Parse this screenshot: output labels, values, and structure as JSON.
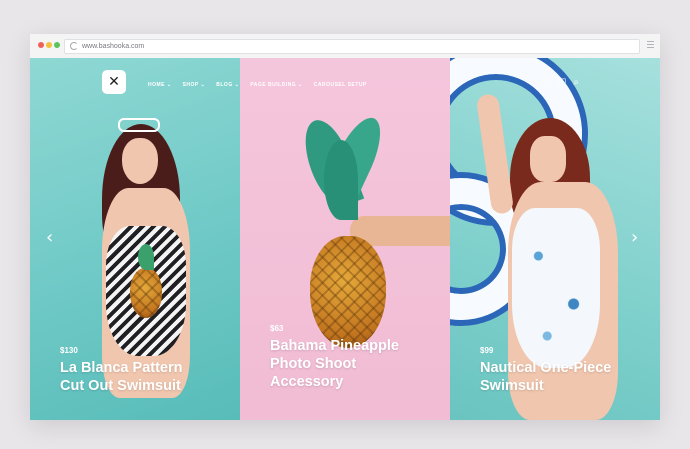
{
  "browser": {
    "url": "www.bashooka.com"
  },
  "header": {
    "logo_glyph": "✕",
    "nav": [
      {
        "label": "HOME ⌄"
      },
      {
        "label": "SHOP ⌄"
      },
      {
        "label": "BLOG ⌄"
      },
      {
        "label": "PAGE BUILDING ⌄"
      },
      {
        "label": "CAROUSEL SETUP"
      }
    ],
    "icons": [
      "heart-icon",
      "bag-icon",
      "search-icon"
    ],
    "icon_glyphs": {
      "heart": "♡",
      "bag": "◫",
      "search": "⌕"
    }
  },
  "slider": {
    "prev_glyph": "‹",
    "next_glyph": "›",
    "slides": [
      {
        "price": "$130",
        "title_line1": "La Blanca Pattern",
        "title_line2": "Cut Out Swimsuit",
        "title_line3": ""
      },
      {
        "price": "$63",
        "title_line1": "Bahama Pineapple",
        "title_line2": "Photo Shoot",
        "title_line3": "Accessory"
      },
      {
        "price": "$99",
        "title_line1": "Nautical One-Piece",
        "title_line2": "Swimsuit",
        "title_line3": ""
      }
    ]
  },
  "colors": {
    "panel1": "#6fc9c6",
    "panel2": "#f1bcd4",
    "panel3": "#7fd0cc",
    "text": "#ffffff"
  }
}
